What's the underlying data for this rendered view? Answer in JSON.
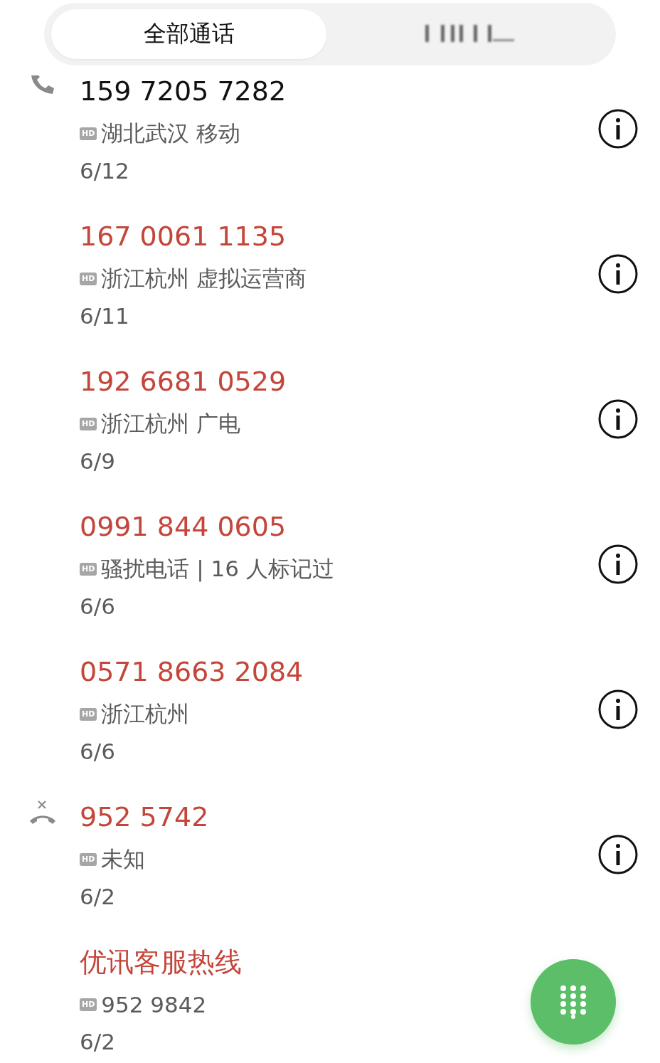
{
  "tabs": [
    {
      "label": "全部通话",
      "selected": true
    },
    {
      "selected": false
    }
  ],
  "calls": [
    {
      "number": "159 7205 7282",
      "missed": false,
      "kind": "incoming",
      "hd_badge": "HD",
      "detail": "湖北武汉 移动",
      "date": "6/12"
    },
    {
      "number": "167 0061 1135",
      "missed": true,
      "kind": "none",
      "hd_badge": "HD",
      "detail": "浙江杭州 虚拟运营商",
      "date": "6/11"
    },
    {
      "number": "192 6681 0529",
      "missed": true,
      "kind": "none",
      "hd_badge": "HD",
      "detail": "浙江杭州 广电",
      "date": "6/9"
    },
    {
      "number": "0991 844 0605",
      "missed": true,
      "kind": "none",
      "hd_badge": "HD",
      "detail": "骚扰电话 | 16 人标记过",
      "date": "6/6"
    },
    {
      "number": "0571 8663 2084",
      "missed": true,
      "kind": "none",
      "hd_badge": "HD",
      "detail": "浙江杭州",
      "date": "6/6"
    },
    {
      "number": "952 5742",
      "missed": true,
      "kind": "rejected",
      "hd_badge": "HD",
      "detail": "未知",
      "date": "6/2"
    },
    {
      "number": "优讯客服热线",
      "missed": true,
      "kind": "none",
      "hd_badge": "HD",
      "detail": "952 9842",
      "date": "6/2",
      "info_hidden": true
    }
  ]
}
